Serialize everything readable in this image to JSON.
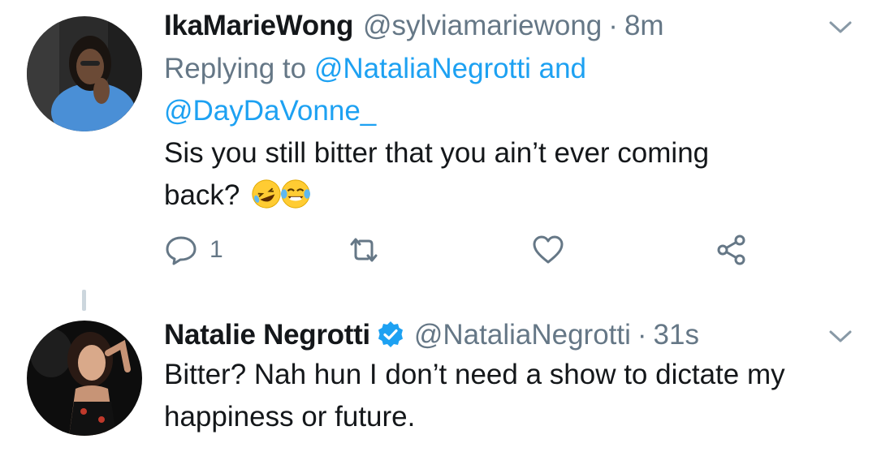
{
  "tweets": [
    {
      "name": "IkaMarieWong",
      "handle": "@sylviamariewong",
      "separator": "·",
      "time": "8m",
      "replying_prefix": "Replying to",
      "replying_mention_1": "@NataliaNegrotti",
      "replying_conj": "and",
      "replying_mention_2": "@DayDaVonne_",
      "text_line_1": "Sis you still bitter that you ain’t ever coming",
      "text_line_2": "back?",
      "emojis": [
        "rolling-on-floor-laughing-emoji",
        "face-with-tears-of-joy-emoji"
      ],
      "actions": {
        "reply_count": "1",
        "icons": [
          "reply-icon",
          "retweet-icon",
          "like-icon",
          "share-icon"
        ]
      }
    },
    {
      "name": "Natalie Negrotti",
      "verified": true,
      "handle": "@NataliaNegrotti",
      "separator": "·",
      "time": "31s",
      "text_line_1": "Bitter? Nah hun I don’t need a show to dictate my",
      "text_line_2": "happiness or future."
    }
  ],
  "colors": {
    "text": "#14171a",
    "secondary": "#657786",
    "link": "#1da1f2",
    "thread_line": "#ccd6dd"
  }
}
